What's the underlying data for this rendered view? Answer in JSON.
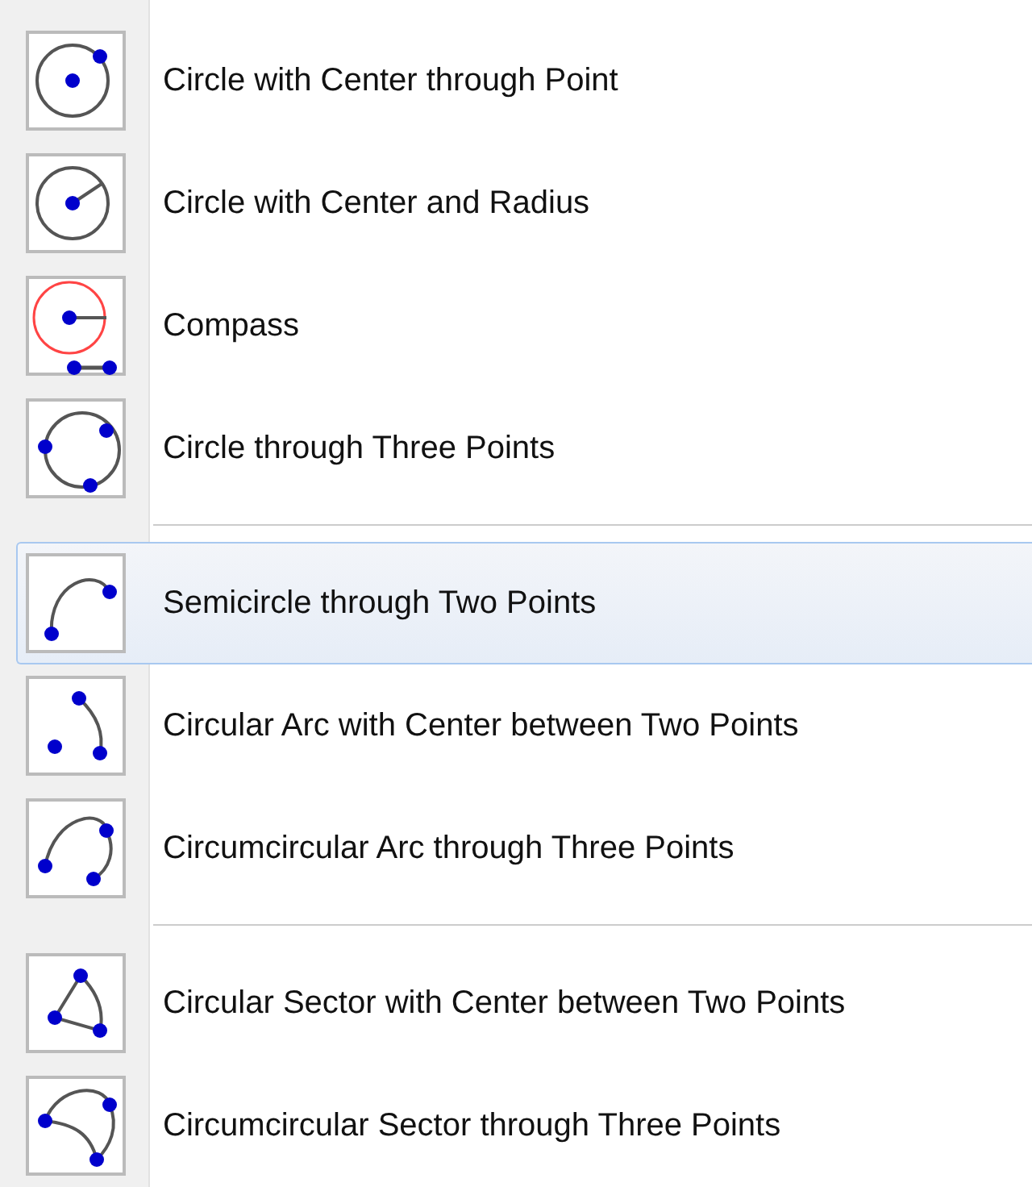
{
  "menu": {
    "groups": [
      {
        "items": [
          {
            "label": "Circle with Center through Point",
            "selected": false
          },
          {
            "label": "Circle with Center and Radius",
            "selected": false
          },
          {
            "label": "Compass",
            "selected": false
          },
          {
            "label": "Circle through Three Points",
            "selected": false
          }
        ]
      },
      {
        "items": [
          {
            "label": "Semicircle through Two Points",
            "selected": true
          },
          {
            "label": "Circular Arc with Center between Two Points",
            "selected": false
          },
          {
            "label": "Circumcircular Arc through Three Points",
            "selected": false
          }
        ]
      },
      {
        "items": [
          {
            "label": "Circular Sector with Center between Two Points",
            "selected": false
          },
          {
            "label": "Circumcircular Sector through Three Points",
            "selected": false
          }
        ]
      }
    ]
  }
}
